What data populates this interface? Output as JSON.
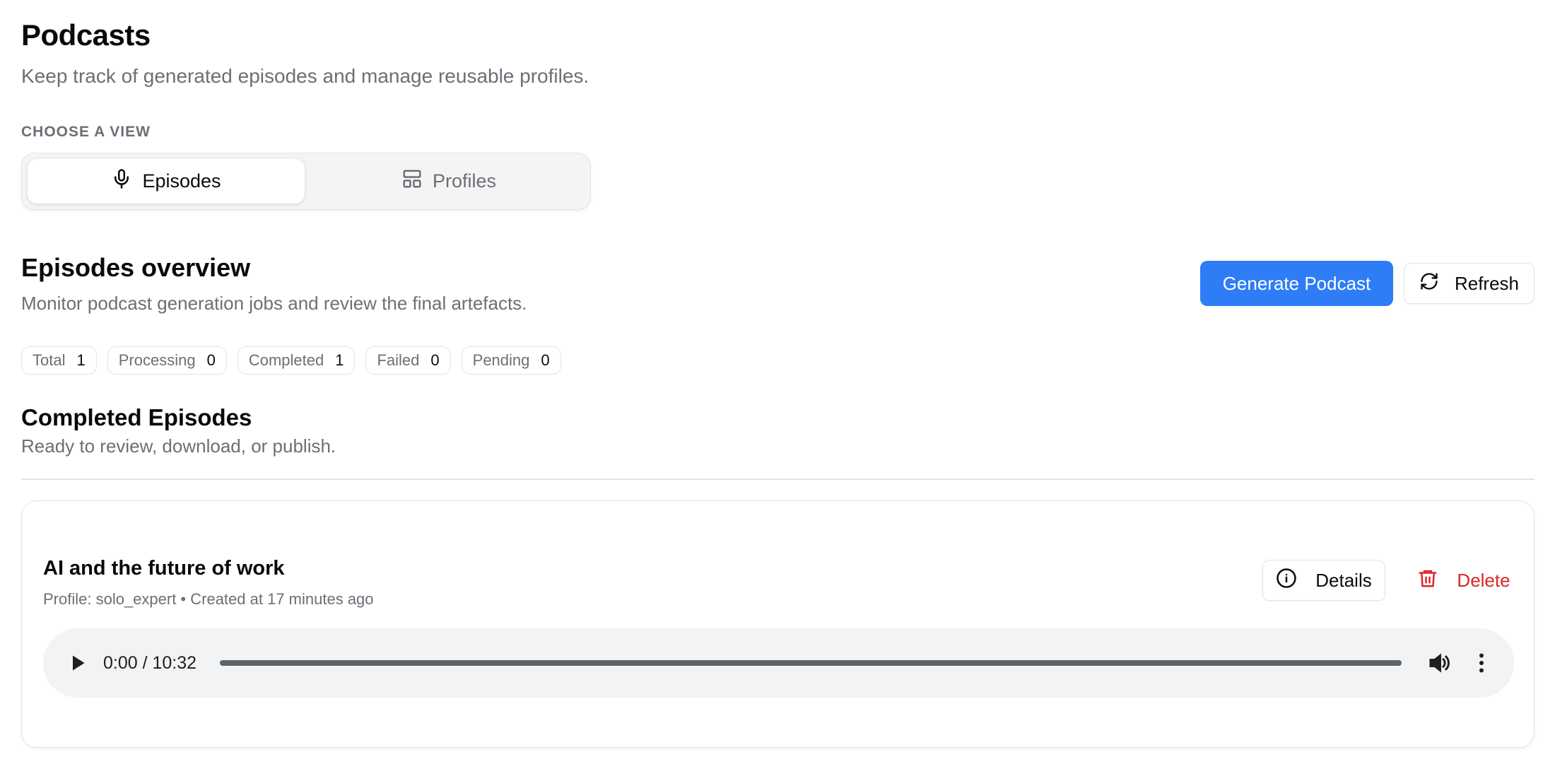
{
  "header": {
    "title": "Podcasts",
    "subtitle": "Keep track of generated episodes and manage reusable profiles."
  },
  "view_selector": {
    "label": "CHOOSE A VIEW",
    "tabs": [
      {
        "label": "Episodes",
        "icon": "microphone-icon",
        "selected": true
      },
      {
        "label": "Profiles",
        "icon": "layout-icon",
        "selected": false
      }
    ]
  },
  "overview": {
    "title": "Episodes overview",
    "subtitle": "Monitor podcast generation jobs and review the final artefacts.",
    "generate_label": "Generate Podcast",
    "refresh_label": "Refresh"
  },
  "stats": [
    {
      "label": "Total",
      "value": "1"
    },
    {
      "label": "Processing",
      "value": "0"
    },
    {
      "label": "Completed",
      "value": "1"
    },
    {
      "label": "Failed",
      "value": "0"
    },
    {
      "label": "Pending",
      "value": "0"
    }
  ],
  "completed": {
    "title": "Completed Episodes",
    "subtitle": "Ready to review, download, or publish."
  },
  "episodes": [
    {
      "title": "AI and the future of work",
      "meta": "Profile: solo_expert • Created at 17 minutes ago",
      "details_label": "Details",
      "delete_label": "Delete",
      "player": {
        "time": "0:00 / 10:32",
        "progress": 0
      }
    }
  ],
  "colors": {
    "primary": "#2f7df6",
    "danger": "#dc2626",
    "muted": "#6b6f76",
    "border": "#e4e4e7"
  }
}
